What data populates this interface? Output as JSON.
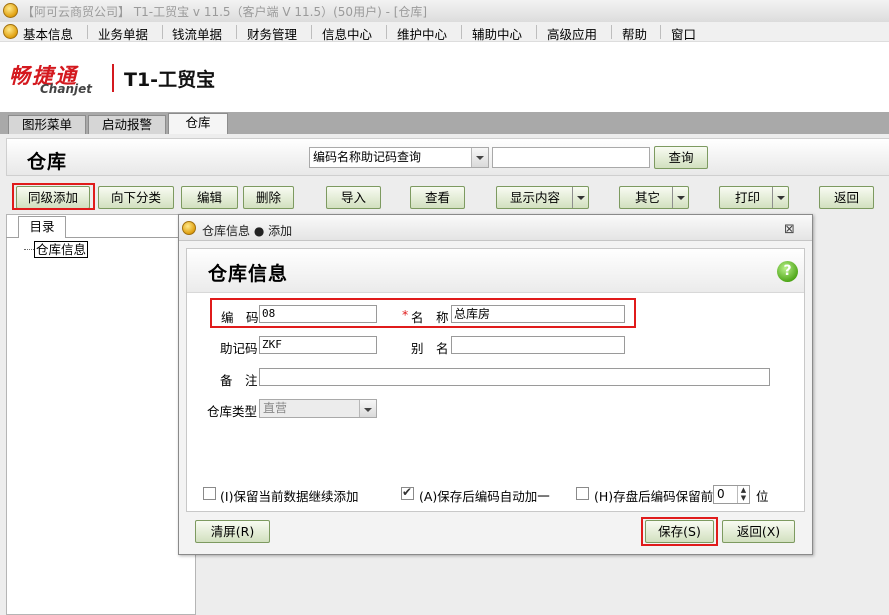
{
  "window": {
    "title": "【阿可云商贸公司】 T1-工贸宝 v 11.5（客户端 V 11.5）(50用户) - [仓库]"
  },
  "menu": [
    "基本信息",
    "业务单据",
    "钱流单据",
    "财务管理",
    "信息中心",
    "维护中心",
    "辅助中心",
    "高级应用",
    "帮助",
    "窗口"
  ],
  "logo": {
    "brand_cn": "畅捷通",
    "brand_en": "Chanjet",
    "product": "T1-工贸宝"
  },
  "tabs": [
    "图形菜单",
    "启动报警",
    "仓库"
  ],
  "header": {
    "title": "仓库",
    "search_field_selected": "编码名称助记码查询",
    "search_value": "",
    "query_button": "查询"
  },
  "toolbar": {
    "add_same_level": "同级添加",
    "add_sub_category": "向下分类",
    "edit": "编辑",
    "delete": "删除",
    "import": "导入",
    "view": "查看",
    "display_content": "显示内容",
    "other": "其它",
    "print": "打印",
    "back": "返回"
  },
  "left_panel": {
    "tab": "目录",
    "tree_root": "仓库信息"
  },
  "dialog": {
    "title": "仓库信息 ● 添加",
    "heading": "仓库信息",
    "help_icon": "?",
    "fields": {
      "code_label": "编　码",
      "code_value": "08",
      "name_required_mark": "*",
      "name_label": "名　称",
      "name_value": "总库房",
      "mnemonic_label": "助记码",
      "mnemonic_value": "ZKF",
      "alias_label": "别　名",
      "alias_value": "",
      "remark_label": "备　注",
      "remark_value": "",
      "type_label": "仓库类型",
      "type_value": "直营"
    },
    "options": {
      "keep_data_label": "(I)保留当前数据继续添加",
      "keep_data_checked": false,
      "auto_increment_label": "(A)保存后编码自动加一",
      "auto_increment_checked": true,
      "keep_prefix_label": "(H)存盘后编码保留前",
      "keep_prefix_checked": false,
      "keep_prefix_value": "0",
      "keep_prefix_unit": "位"
    },
    "buttons": {
      "clear": "清屏(R)",
      "save": "保存(S)",
      "back": "返回(X)"
    }
  },
  "colors": {
    "highlight_red": "#e01b1b",
    "logo_red": "#d4191f",
    "help_green": "#4aa314"
  }
}
